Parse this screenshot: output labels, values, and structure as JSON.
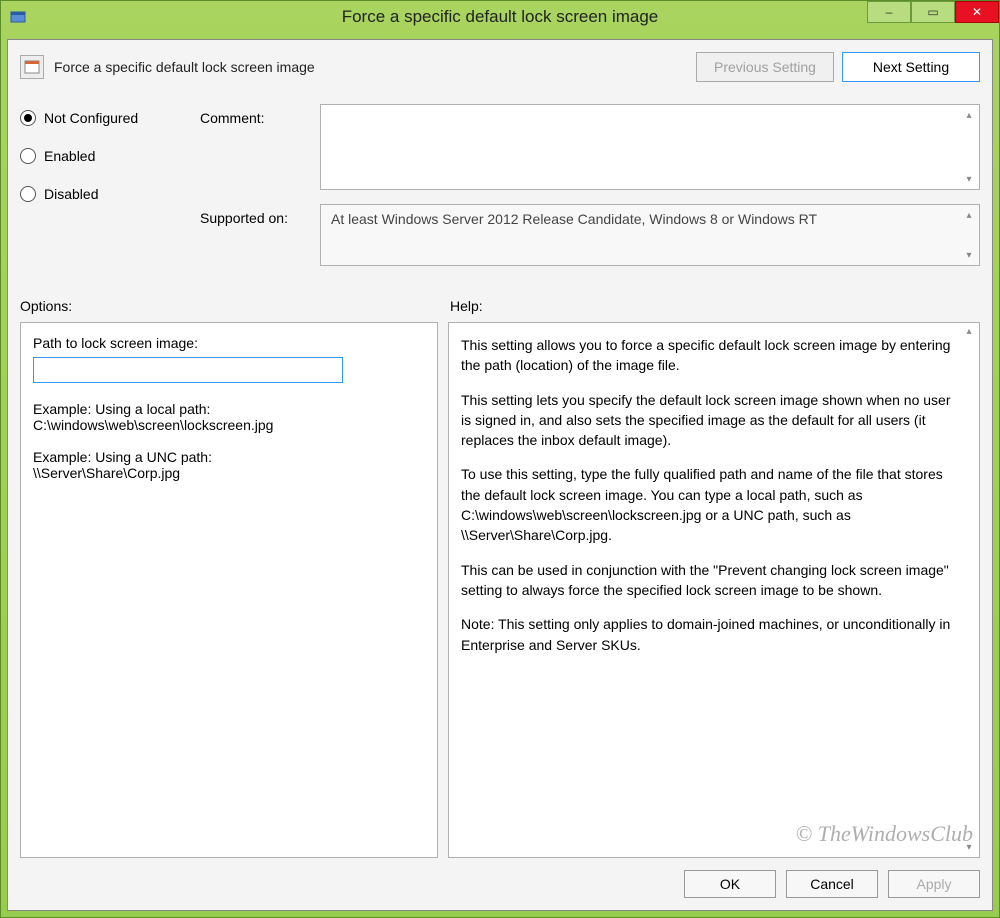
{
  "window": {
    "title": "Force a specific default lock screen image"
  },
  "caption": {
    "minimize": "–",
    "maximize": "▭",
    "close": "✕"
  },
  "header": {
    "title": "Force a specific default lock screen image",
    "prev": "Previous Setting",
    "next": "Next Setting"
  },
  "state": {
    "not_configured": "Not Configured",
    "enabled": "Enabled",
    "disabled": "Disabled",
    "selected": "not_configured"
  },
  "fields": {
    "comment_label": "Comment:",
    "supported_label": "Supported on:",
    "supported_value": "At least Windows Server 2012 Release Candidate, Windows 8 or Windows RT"
  },
  "sections": {
    "options": "Options:",
    "help": "Help:"
  },
  "options": {
    "path_label": "Path to lock screen image:",
    "path_value": "",
    "example1_label": "Example: Using a local path:",
    "example1_value": "C:\\windows\\web\\screen\\lockscreen.jpg",
    "example2_label": "Example: Using a UNC path:",
    "example2_value": "\\\\Server\\Share\\Corp.jpg"
  },
  "help": {
    "p1": "This setting allows you to force a specific default lock screen image by entering the path (location) of the image file.",
    "p2": "This setting lets you specify the default lock screen image shown when no user is signed in, and also sets the specified image as the default for all users (it replaces the inbox default image).",
    "p3": "To use this setting, type the fully qualified path and name of the file that stores the default lock screen image. You can type a local path, such as C:\\windows\\web\\screen\\lockscreen.jpg or a UNC path, such as \\\\Server\\Share\\Corp.jpg.",
    "p4": "This can be used in conjunction with the \"Prevent changing lock screen image\" setting to always force the specified lock screen image to be shown.",
    "p5": "Note: This setting only applies to domain-joined machines, or unconditionally in Enterprise and Server SKUs."
  },
  "footer": {
    "ok": "OK",
    "cancel": "Cancel",
    "apply": "Apply"
  },
  "watermark": "© TheWindowsClub"
}
